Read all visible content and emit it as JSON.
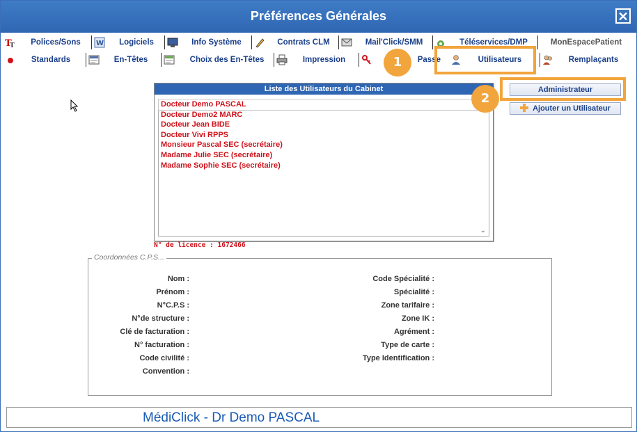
{
  "window": {
    "title": "Préférences Générales",
    "close_label": "✕"
  },
  "tabs_row1": [
    {
      "label": "Polices/Sons",
      "icon": "font-icon"
    },
    {
      "label": "Logiciels",
      "icon": "word-icon"
    },
    {
      "label": "Info Système",
      "icon": "computer-icon"
    },
    {
      "label": "Contrats CLM",
      "icon": "pencil-icon"
    },
    {
      "label": "Mail'Click/SMM",
      "icon": "mail-icon"
    },
    {
      "label": "Téléservices/DMP",
      "icon": "network-icon"
    },
    {
      "label": "MonEspacePatient",
      "icon": ""
    }
  ],
  "tabs_row2": [
    {
      "label": "Standards",
      "icon": "red-dot-icon"
    },
    {
      "label": "En-Têtes",
      "icon": "header-icon"
    },
    {
      "label": "Choix des En-Têtes",
      "icon": "header-choice-icon"
    },
    {
      "label": "Impression",
      "icon": "printer-icon"
    },
    {
      "label": "Passe",
      "icon": "key-icon"
    },
    {
      "label": "Utilisateurs",
      "icon": "user-icon"
    },
    {
      "label": "Remplaçants",
      "icon": "users-icon"
    }
  ],
  "user_panel": {
    "title": "Liste des Utilisateurs du Cabinet",
    "users": [
      "Docteur Demo PASCAL",
      "Docteur Demo2 MARC",
      "Docteur Jean BIDE",
      "Docteur Vivi RPPS",
      "Monsieur Pascal SEC (secrétaire)",
      "Madame Julie SEC (secrétaire)",
      "Madame Sophie SEC (secrétaire)"
    ],
    "licence": "N° de licence : 1672466"
  },
  "buttons": {
    "admin": "Administrateur",
    "add_user": "Ajouter un Utilisateur"
  },
  "badges": {
    "one": "1",
    "two": "2"
  },
  "cps": {
    "legend": "Coordonnées C.P.S...",
    "left_fields": [
      "Nom :",
      "Prénom :",
      "N°C.P.S :",
      "N°de structure :",
      "Clé de facturation :",
      "N° facturation :",
      "Code civilité :",
      "Convention :"
    ],
    "right_fields": [
      "Code Spécialité :",
      "Spécialité :",
      "Zone tarifaire :",
      "Zone IK :",
      "Agrément :",
      "Type de carte :",
      "Type Identification :"
    ]
  },
  "footer": {
    "text": "MédiClick - Dr Demo PASCAL"
  },
  "colors": {
    "accent": "#2f66b3",
    "highlight": "#f2a53c",
    "user_text": "#d0121b"
  }
}
